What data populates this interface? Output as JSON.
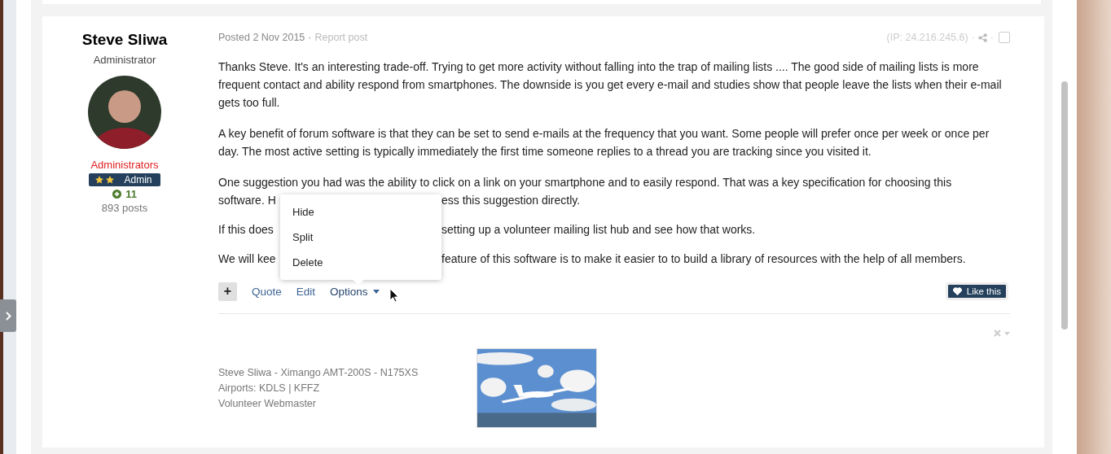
{
  "author": {
    "name": "Steve Sliwa",
    "title": "Administrator",
    "group": "Administrators",
    "rank_badge": {
      "label": "Admin"
    },
    "reputation": "11",
    "posts": "893 posts"
  },
  "post": {
    "posted": "Posted 2 Nov 2015",
    "separator": "·",
    "report": "Report post",
    "ip": "(IP: 24.216.245.6)",
    "ip_separator": "·",
    "share_separator": "·",
    "checked": false,
    "paragraphs": [
      {
        "text": "Thanks Steve. It's an interesting trade-off. Trying to get more activity without falling into the trap of mailing lists .... The good side of mailing lists is more frequent contact and ability respond from smartphones. The downside is you get every e-mail and studies show that people leave the lists when their e-mail gets too full."
      },
      {
        "text": "A key benefit of forum software is that they can be set to send e-mails at the frequency that you want. Some people will prefer once per week or once per day. The most active setting is typically immediately the first time someone replies to a thread you are tracking since you visited it."
      },
      {
        "text": "One suggestion you had was the ability to click on a link on your smartphone and to easily respond. That was a key specification for choosing this",
        "covered": {
          "before": "software. H",
          "after": "ess this suggestion directly."
        }
      },
      {
        "covered": {
          "before": "If this does",
          "after": "setting up a volunteer mailing list hub and see how that works."
        }
      },
      {
        "covered": {
          "before": "We will kee",
          "after": "feature of this software is to make it easier to to build a library of resources with the help of all members."
        }
      }
    ],
    "actions": {
      "multiquote": "+",
      "links": [
        "Quote",
        "Edit"
      ],
      "options": {
        "label": "Options",
        "expanded": true,
        "menu": [
          "Hide",
          "Split",
          "Delete"
        ]
      },
      "like": "Like this"
    },
    "signature": {
      "lines": [
        "Steve Sliwa - Ximango AMT-200S - N175XS",
        "Airports: KDLS | KFFZ",
        "Volunteer Webmaster"
      ]
    }
  }
}
